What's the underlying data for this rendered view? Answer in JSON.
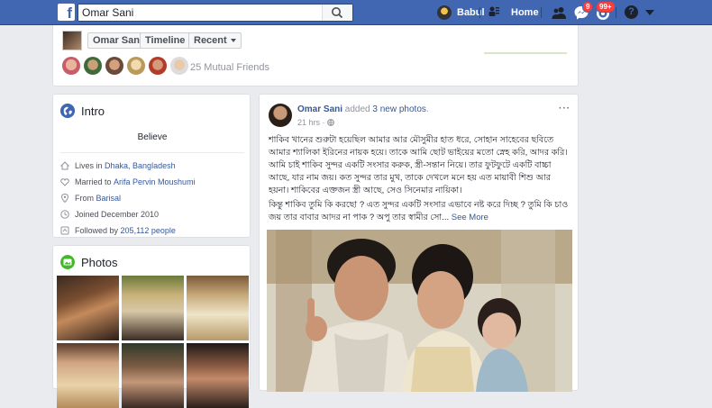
{
  "topbar": {
    "logo": "f",
    "search_value": "Omar Sani",
    "user_name": "Babul",
    "home_label": "Home",
    "messages_badge": "9",
    "notifications_badge": "99+",
    "help_label": "?",
    "icons": [
      "search-icon",
      "friend-requests-icon",
      "messages-icon",
      "notifications-icon",
      "help-icon",
      "settings-caret-icon"
    ]
  },
  "profile_strip": {
    "name": "Omar Sani",
    "timeline_label": "Timeline",
    "recent_label": "Recent",
    "mutual_friends": "25 Mutual Friends",
    "mutual_avatar_count": 6
  },
  "intro": {
    "title": "Intro",
    "bio": "Believe",
    "lives_prefix": "Lives in ",
    "lives_link": "Dhaka, Bangladesh",
    "married_prefix": "Married to ",
    "married_link": "Arifa Pervin Moushumi",
    "from_prefix": "From ",
    "from_link": "Barisal",
    "joined": "Joined December 2010",
    "followed_prefix": "Followed by ",
    "followed_link": "205,112 people"
  },
  "photos": {
    "title": "Photos"
  },
  "post": {
    "author": "Omar Sani",
    "action_prefix": " added ",
    "action_link": "3 new photos",
    "action_suffix": ".",
    "time": "21 hrs · ",
    "more": "···",
    "paragraph1": "শাকিব খানের শুরুটা হয়েছিল আমার আর মৌসুমীর হাত ধরে, সোহান সাহেবের ছবিতে আমার শ্যালিকা ইরিনের নায়ক হয়ে। তাকে আমি ছোট ভাইয়ের মতো স্নেহ করি, আদর করি। আমি চাই শাকিব সুন্দর একটি সংসার করুক, স্ত্রী-সন্তান নিয়ে। তার ফুটফুটে একটি বাচ্চা আছে, যার নাম জয়। কত সুন্দর তার মুখ, তাকে দেখলে মনে হয় এত মায়াবী শিশু আর হয়না। শাকিবের এক্তজন স্ত্রী আছে, সেও সিনেমার নায়িকা।",
    "paragraph2": "কিন্তু শাকিব তুমি কি করছো ? এত সুন্দর একটি সংসার এভাবে নষ্ট করে দিচ্ছ ? তুমি কি চাও জয় তার বাবার আদর না পাক ? অপু তার স্বামীর সো... ",
    "see_more": "See More"
  }
}
